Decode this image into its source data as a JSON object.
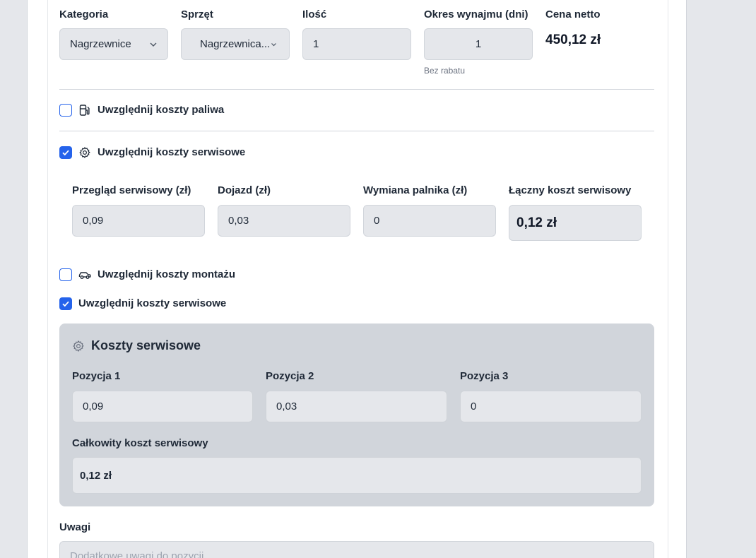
{
  "row": {
    "category": {
      "label": "Kategoria",
      "value": "Nagrzewnice"
    },
    "equipment": {
      "label": "Sprzęt",
      "value": "Nagrzewnica..."
    },
    "quantity": {
      "label": "Ilość",
      "value": "1"
    },
    "period": {
      "label": "Okres wynajmu (dni)",
      "value": "1",
      "hint": "Bez rabatu"
    },
    "net_price": {
      "label": "Cena netto",
      "value": "450,12 zł"
    }
  },
  "options": {
    "fuel": {
      "label": "Uwzględnij koszty paliwa",
      "checked": false,
      "icon": "fuel-pump-icon"
    },
    "service": {
      "label": "Uwzględnij koszty serwisowe",
      "checked": true,
      "icon": "gear-icon"
    },
    "assembly": {
      "label": "Uwzględnij koszty montażu",
      "checked": false,
      "icon": "car-icon"
    },
    "service2": {
      "label": "Uwzględnij koszty serwisowe",
      "checked": true
    }
  },
  "service_fields": {
    "inspection": {
      "label": "Przegląd serwisowy (zł)",
      "value": "0,09"
    },
    "travel": {
      "label": "Dojazd (zł)",
      "value": "0,03"
    },
    "burner": {
      "label": "Wymiana palnika (zł)",
      "value": "0"
    },
    "total": {
      "label": "Łączny koszt serwisowy",
      "value": "0,12 zł"
    }
  },
  "service_panel": {
    "title": "Koszty serwisowe",
    "items": [
      {
        "label": "Pozycja 1",
        "value": "0,09"
      },
      {
        "label": "Pozycja 2",
        "value": "0,03"
      },
      {
        "label": "Pozycja 3",
        "value": "0"
      }
    ],
    "total_label": "Całkowity koszt serwisowy",
    "total_value": "0,12 zł"
  },
  "notes": {
    "label": "Uwagi",
    "placeholder": "Dodatkowe uwagi do pozycji"
  },
  "colors": {
    "accent": "#2563eb",
    "field_bg": "#e5e7eb",
    "panel_bg": "#d1d5db"
  }
}
